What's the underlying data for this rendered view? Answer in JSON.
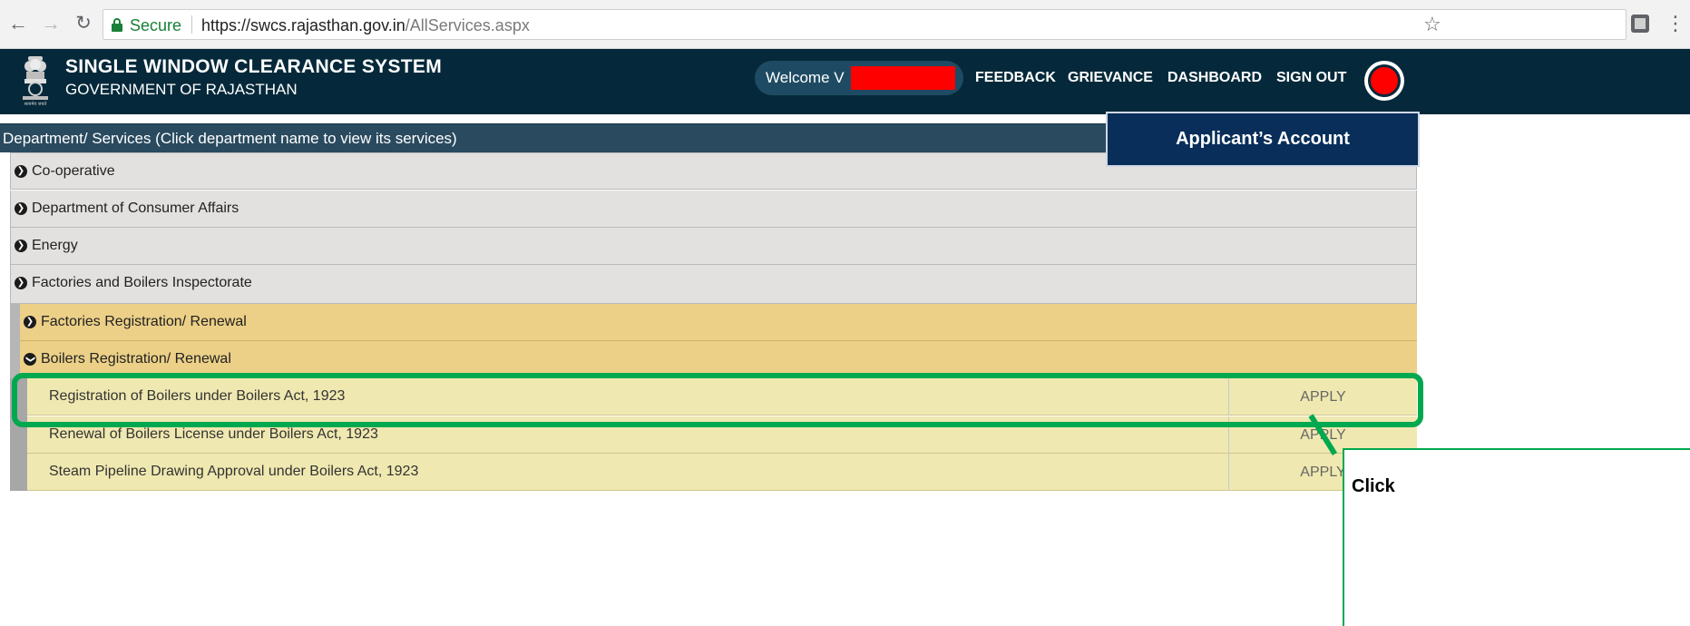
{
  "browser": {
    "secure_label": "Secure",
    "url_host": "https://swcs.rajasthan.gov.in",
    "url_path": "/AllServices.aspx",
    "icons": [
      "back-arrow-icon",
      "forward-arrow-icon",
      "reload-icon",
      "lock-icon",
      "bookmark-star-icon",
      "extension-icon",
      "menu-icon"
    ]
  },
  "header": {
    "title": "SINGLE WINDOW CLEARANCE SYSTEM",
    "subtitle": "GOVERNMENT OF RAJASTHAN",
    "emblem_caption": "सत्यमेव जयते",
    "welcome": "Welcome V",
    "nav": [
      "FEEDBACK",
      "GRIEVANCE",
      "DASHBOARD",
      "SIGN OUT"
    ],
    "colors": {
      "background": "#05293a",
      "pill": "#1e4b63",
      "redaction": "#ff0000"
    }
  },
  "content": {
    "section_header": "Department/ Services (Click department name to view its services)",
    "departments": [
      "Co-operative",
      "Department of Consumer Affairs",
      "Energy",
      "Factories and Boilers Inspectorate"
    ],
    "subcategories": [
      {
        "label": "Factories Registration/ Renewal",
        "expanded": false
      },
      {
        "label": "Boilers Registration/ Renewal",
        "expanded": true
      }
    ],
    "services": [
      {
        "name": "Registration of Boilers under Boilers Act, 1923",
        "action": "APPLY"
      },
      {
        "name": "Renewal of Boilers License under Boilers Act, 1923",
        "action": "APPLY"
      },
      {
        "name": "Steam Pipeline Drawing Approval under Boilers Act, 1923",
        "action": "APPLY"
      }
    ],
    "colors": {
      "section_header": "#294a5f",
      "department_row": "#e3e1df",
      "subcategory_row": "#ecd087",
      "service_row": "#efe8b0"
    }
  },
  "annotations": {
    "account_callout": "Applicant’s Account",
    "click_callout": "Click",
    "colors": {
      "highlight": "#00a84f",
      "callout": "#082e59"
    }
  }
}
